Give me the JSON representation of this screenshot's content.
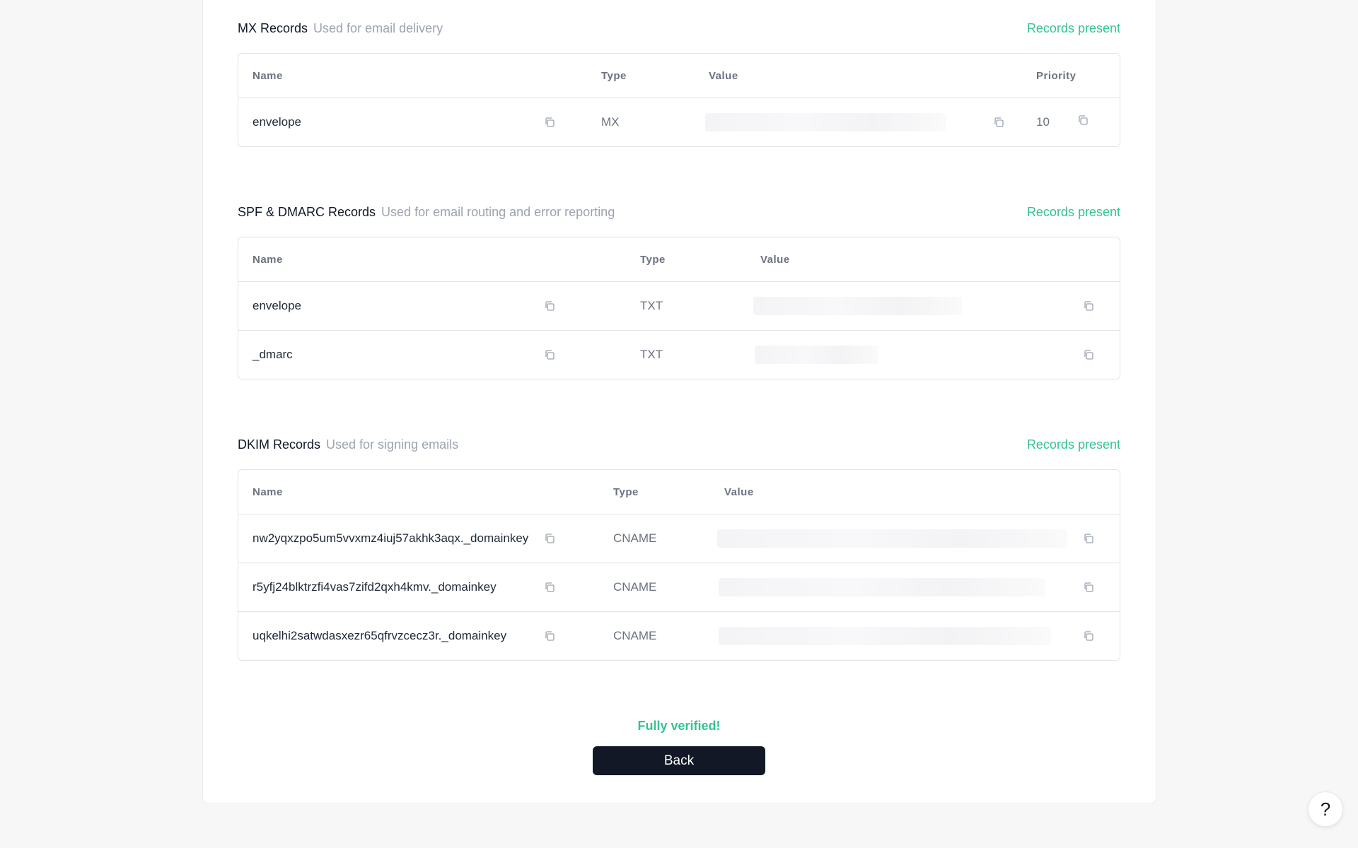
{
  "mx": {
    "title": "MX Records",
    "subtitle": "Used for email delivery",
    "status": "Records present",
    "headers": {
      "name": "Name",
      "type": "Type",
      "value": "Value",
      "priority": "Priority"
    },
    "rows": [
      {
        "name": "envelope",
        "type": "MX",
        "priority": "10"
      }
    ]
  },
  "spf": {
    "title": "SPF & DMARC Records",
    "subtitle": "Used for email routing and error reporting",
    "status": "Records present",
    "headers": {
      "name": "Name",
      "type": "Type",
      "value": "Value"
    },
    "rows": [
      {
        "name": "envelope",
        "type": "TXT"
      },
      {
        "name": "_dmarc",
        "type": "TXT"
      }
    ]
  },
  "dkim": {
    "title": "DKIM Records",
    "subtitle": "Used for signing emails",
    "status": "Records present",
    "headers": {
      "name": "Name",
      "type": "Type",
      "value": "Value"
    },
    "rows": [
      {
        "name": "nw2yqxzpo5um5vvxmz4iuj57akhk3aqx._domainkey",
        "type": "CNAME"
      },
      {
        "name": "r5yfj24blktrzfi4vas7zifd2qxh4kmv._domainkey",
        "type": "CNAME"
      },
      {
        "name": "uqkelhi2satwdasxezr65qfrvzcecz3r._domainkey",
        "type": "CNAME"
      }
    ]
  },
  "footer": {
    "verified_text": "Fully verified!",
    "back_label": "Back",
    "help_label": "?"
  },
  "colors": {
    "accent_green": "#34c38f",
    "button_dark": "#121826"
  },
  "icons": {
    "copy": "copy-icon",
    "help": "question-mark-icon"
  }
}
